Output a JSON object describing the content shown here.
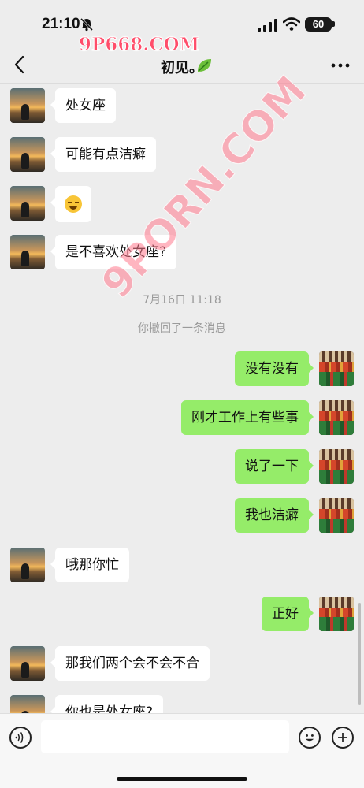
{
  "status": {
    "time": "21:10",
    "battery": "60"
  },
  "header": {
    "title": "初见。",
    "watermark": "9P668.COM"
  },
  "watermark_diagonal": "9PORN.COM",
  "colors": {
    "background": "#ededed",
    "bubble_self": "#95ec69",
    "bubble_other": "#ffffff",
    "system_text": "#9a9a9a"
  },
  "messages": [
    {
      "side": "left",
      "text": "处女座"
    },
    {
      "side": "left",
      "text": "可能有点洁癖"
    },
    {
      "side": "left",
      "type": "emoji",
      "emoji": "laughing-crying-emoji"
    },
    {
      "side": "left",
      "text": "是不喜欢处女座?"
    },
    {
      "side": "left",
      "text": "哦那你忙"
    },
    {
      "side": "right",
      "text": "正好"
    },
    {
      "side": "left",
      "text": "那我们两个会不会不合"
    },
    {
      "side": "left",
      "text": "你也是处女座?"
    }
  ],
  "system": {
    "timestamp": "7月16日 11:18",
    "recall_notice": "你撤回了一条消息"
  },
  "replies": [
    {
      "side": "right",
      "text": "没有没有"
    },
    {
      "side": "right",
      "text": "刚才工作上有些事"
    },
    {
      "side": "right",
      "text": "说了一下"
    },
    {
      "side": "right",
      "text": "我也洁癖"
    }
  ],
  "input": {
    "value": ""
  }
}
